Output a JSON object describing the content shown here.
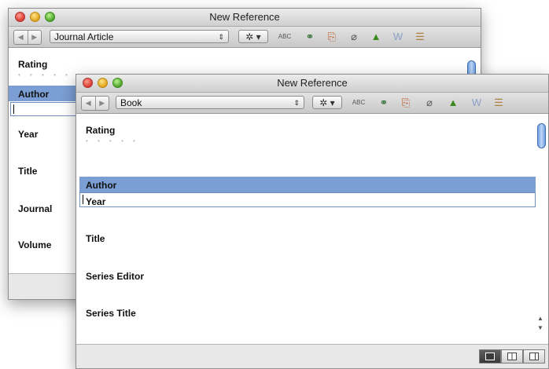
{
  "back_window": {
    "title": "New Reference",
    "nav": {
      "back": "◀",
      "forward": "▶"
    },
    "reference_type": "Journal Article",
    "gear_label": "✲ ▾",
    "fields": [
      "Rating",
      "Author",
      "Year",
      "Title",
      "Journal",
      "Volume"
    ]
  },
  "front_window": {
    "title": "New Reference",
    "nav": {
      "back": "◀",
      "forward": "▶"
    },
    "reference_type": "Book",
    "gear_label": "✲ ▾",
    "fields": [
      "Rating",
      "Author",
      "Year",
      "Title",
      "Series Editor",
      "Series Title"
    ]
  },
  "toolbar_icons": {
    "spellcheck": "ABC✓",
    "find_fulltext": "⚭",
    "insert_citation": "⎘",
    "attach": "⌀",
    "thumbs": "👍",
    "word": "W",
    "list": "☰"
  },
  "stars": "• • • • •",
  "colors": {
    "selection": "#7b9fd4",
    "scroll_thumb": "#6f9fe0"
  }
}
